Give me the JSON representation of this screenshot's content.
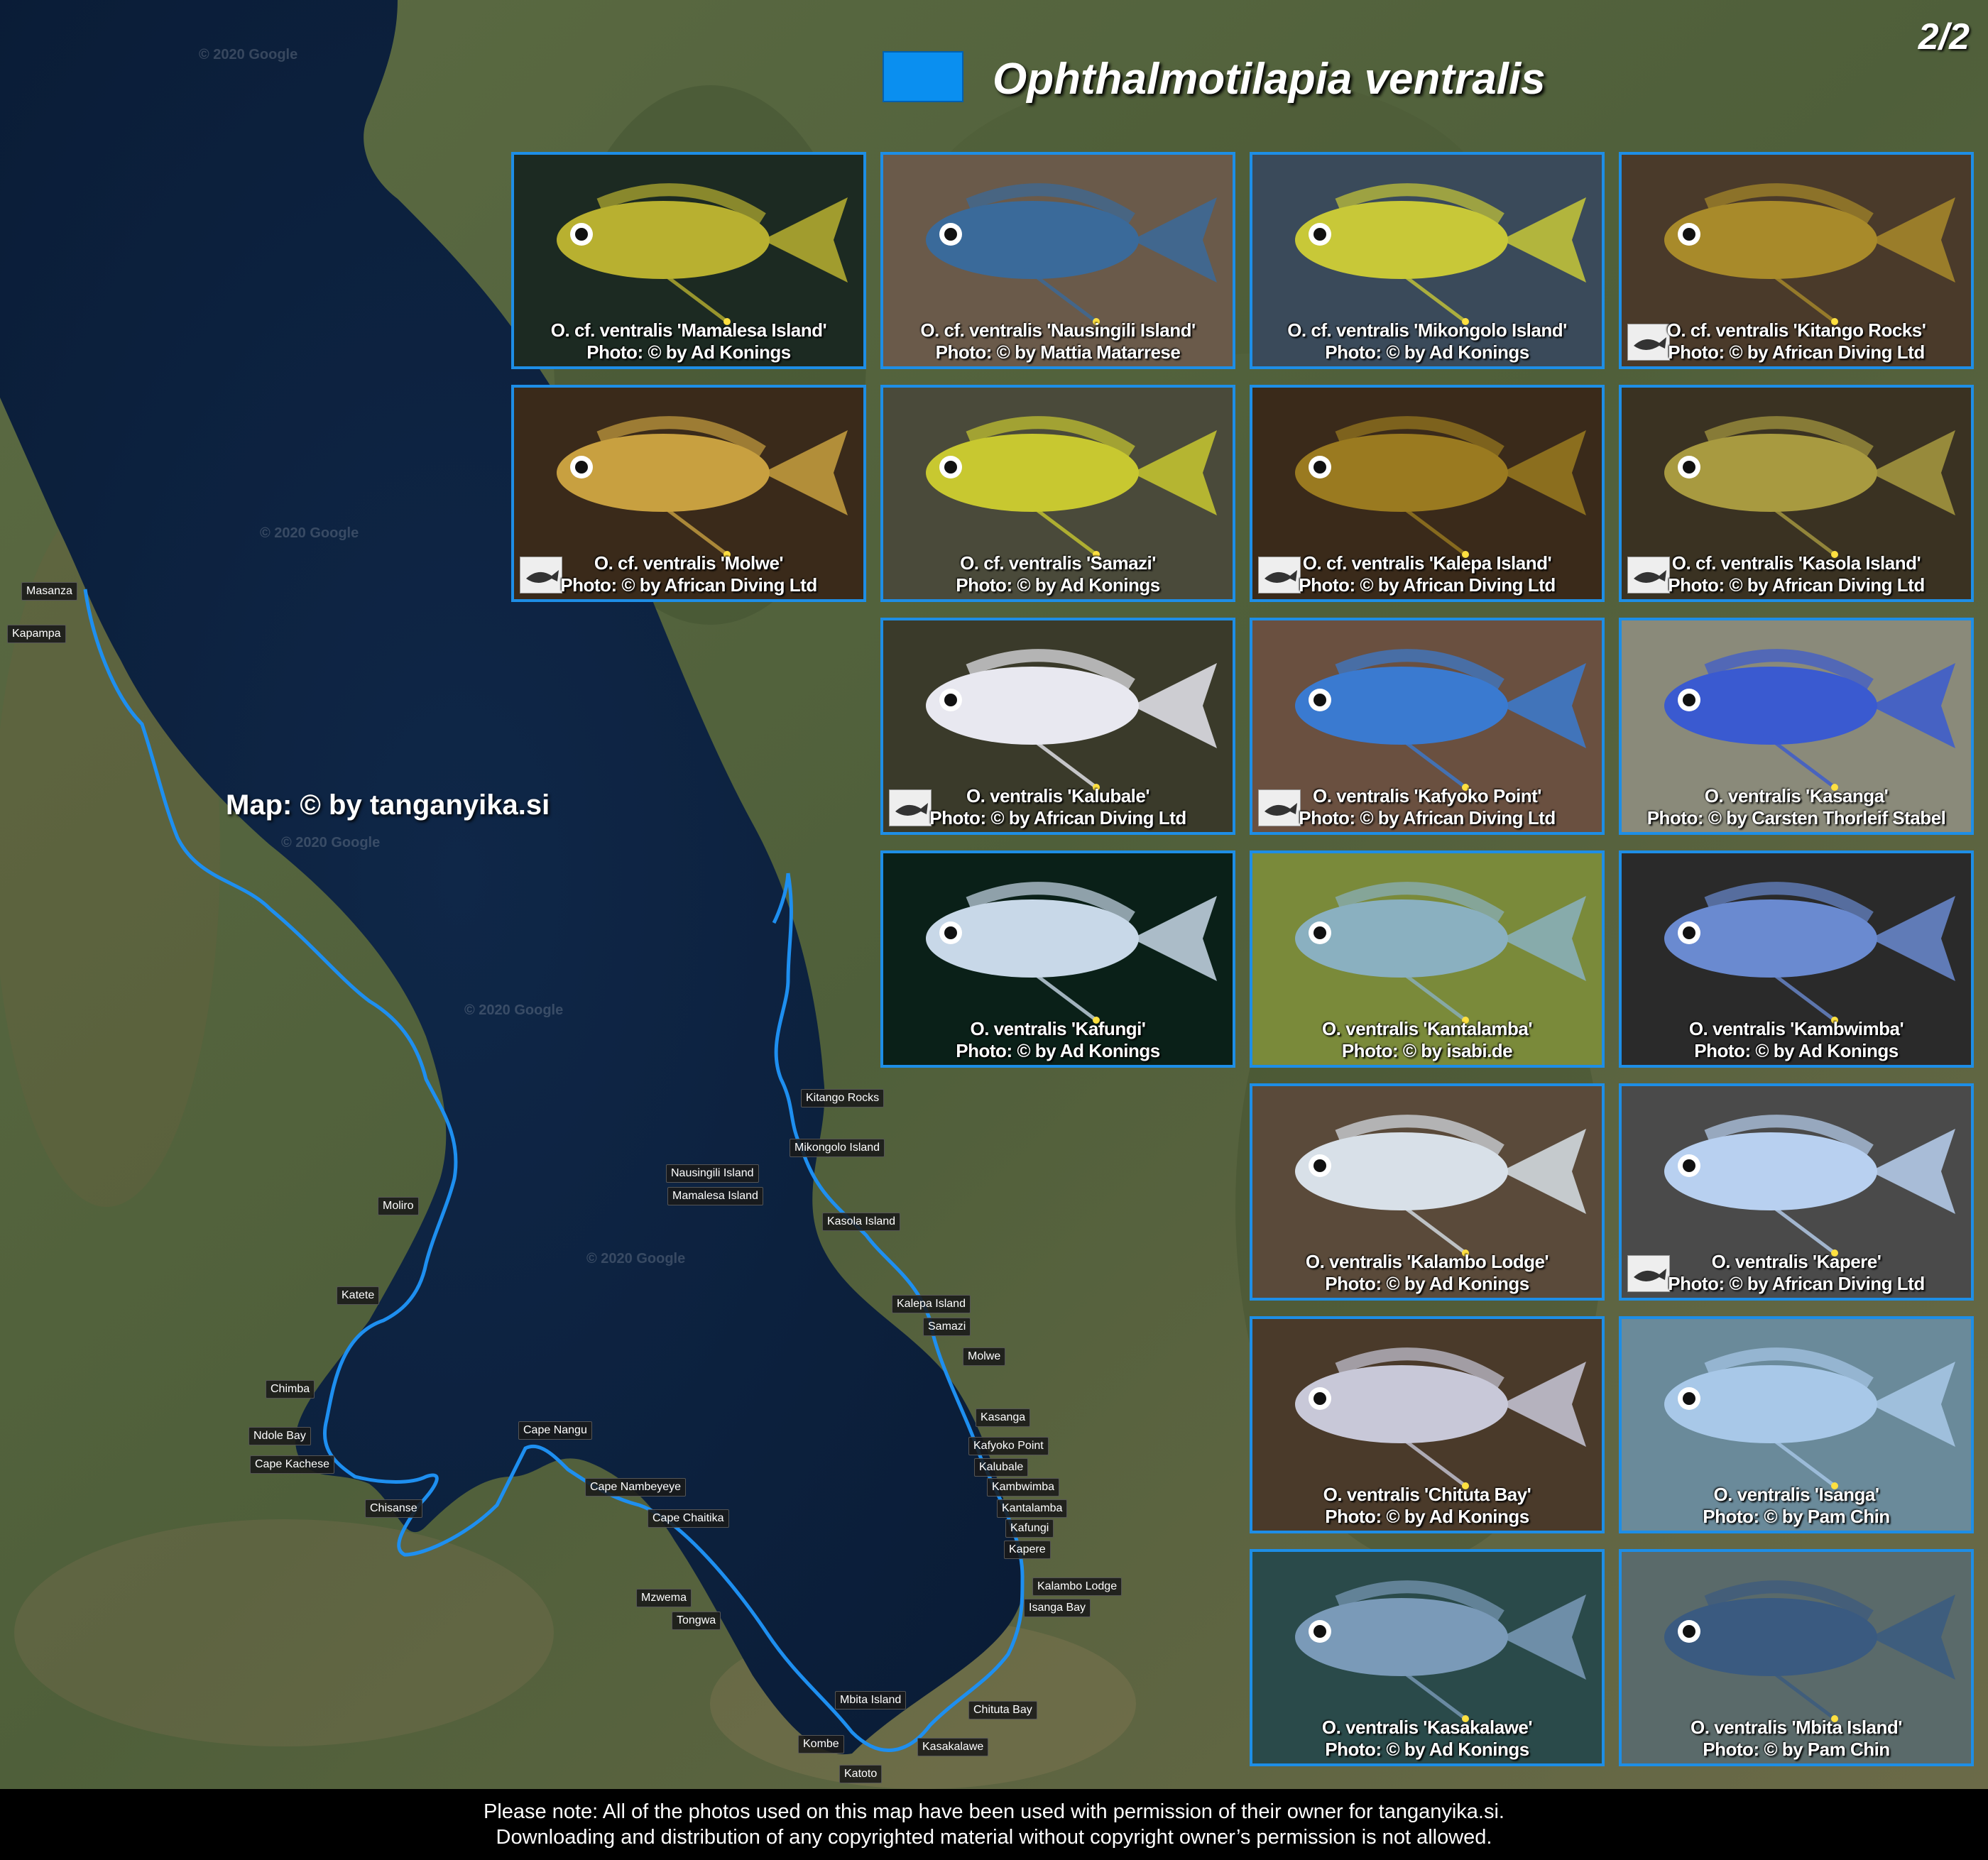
{
  "page_number": "2/2",
  "legend": {
    "color": "#0a8ff0",
    "species": "Ophthalmotilapia ventralis"
  },
  "map_credit": "Map: © by tanganyika.si",
  "watermark": "© 2020 Google",
  "locations": [
    "Masanza",
    "Kapampa",
    "Moliro",
    "Katete",
    "Chimba",
    "Ndole Bay",
    "Cape Kachese",
    "Chisanse",
    "Cape Nangu",
    "Cape Nambeyeye",
    "Cape Chaitika",
    "Mzwema",
    "Tongwa",
    "Mbita Island",
    "Kombe",
    "Katoto",
    "Kasakalawe",
    "Chituta Bay",
    "Isanga Bay",
    "Kalambo Lodge",
    "Kapere",
    "Kafungi",
    "Kantalamba",
    "Kambwimba",
    "Kalubale",
    "Kafyoko Point",
    "Kasanga",
    "Molwe",
    "Samazi",
    "Kalepa Island",
    "Kasola Island",
    "Mamalesa Island",
    "Nausingili Island",
    "Mikongolo Island",
    "Kitango Rocks"
  ],
  "photos": [
    {
      "name": "O. cf. ventralis 'Mamalesa Island'",
      "credit": "Photo: © by Ad Konings",
      "bg": "#1c2a22",
      "body": "#b8b030",
      "logo": false
    },
    {
      "name": "O. cf. ventralis 'Nausingili Island'",
      "credit": "Photo: © by Mattia Matarrese",
      "bg": "#6a5a4a",
      "body": "#3a6a9a",
      "logo": false
    },
    {
      "name": "O. cf. ventralis 'Mikongolo Island'",
      "credit": "Photo: © by Ad Konings",
      "bg": "#3a4a5a",
      "body": "#c8c838",
      "logo": false
    },
    {
      "name": "O. cf. ventralis 'Kitango Rocks'",
      "credit": "Photo: © by African Diving Ltd",
      "bg": "#4a3a2a",
      "body": "#a88a2a",
      "logo": true
    },
    {
      "name": "O. cf. ventralis 'Molwe'",
      "credit": "Photo: © by African Diving Ltd",
      "bg": "#3a2a1a",
      "body": "#c8a040",
      "logo": true
    },
    {
      "name": "O. cf. ventralis 'Samazi'",
      "credit": "Photo: © by Ad Konings",
      "bg": "#4a4a3a",
      "body": "#c8c830",
      "logo": false
    },
    {
      "name": "O. cf. ventralis 'Kalepa Island'",
      "credit": "Photo: © by African Diving Ltd",
      "bg": "#3a2a1a",
      "body": "#9a7a20",
      "logo": true
    },
    {
      "name": "O. cf. ventralis 'Kasola Island'",
      "credit": "Photo: © by African Diving Ltd",
      "bg": "#3a3222",
      "body": "#a89a40",
      "logo": true
    },
    {
      "name": "O. ventralis 'Kalubale'",
      "credit": "Photo: © by African Diving Ltd",
      "bg": "#3a3a2a",
      "body": "#e8e8f0",
      "logo": true
    },
    {
      "name": "O. ventralis 'Kafyoko Point'",
      "credit": "Photo: © by African Diving Ltd",
      "bg": "#6a5040",
      "body": "#3a7ad0",
      "logo": true
    },
    {
      "name": "O. ventralis 'Kasanga'",
      "credit": "Photo: © by Carsten Thorleif Stabel",
      "bg": "#8a8a7a",
      "body": "#3a5ad0",
      "logo": false
    },
    {
      "name": "O. ventralis 'Kafungi'",
      "credit": "Photo: © by Ad Konings",
      "bg": "#0a2018",
      "body": "#c8d8e8",
      "logo": false
    },
    {
      "name": "O. ventralis 'Kantalamba'",
      "credit": "Photo: © by isabi.de",
      "bg": "#7a8a3a",
      "body": "#8ab0c0",
      "logo": false
    },
    {
      "name": "O. ventralis 'Kambwimba'",
      "credit": "Photo: © by Ad Konings",
      "bg": "#2a2a2a",
      "body": "#6a8ad0",
      "logo": false
    },
    {
      "name": "O. ventralis 'Kalambo Lodge'",
      "credit": "Photo: © by Ad Konings",
      "bg": "#5a4a3a",
      "body": "#d8e0e8",
      "logo": false
    },
    {
      "name": "O. ventralis 'Kapere'",
      "credit": "Photo: © by African Diving Ltd",
      "bg": "#4a4a4a",
      "body": "#b8d0f0",
      "logo": true
    },
    {
      "name": "O. ventralis 'Chituta Bay'",
      "credit": "Photo: © by Ad Konings",
      "bg": "#4a3a2a",
      "body": "#c8c8d8",
      "logo": false
    },
    {
      "name": "O. ventralis 'Isanga'",
      "credit": "Photo: © by Pam Chin",
      "bg": "#6a8a9a",
      "body": "#a8c8e8",
      "logo": false
    },
    {
      "name": "O. ventralis 'Kasakalawe'",
      "credit": "Photo: © by Ad Konings",
      "bg": "#2a4a4a",
      "body": "#7a9ab8",
      "logo": false
    },
    {
      "name": "O. ventralis 'Mbita Island'",
      "credit": "Photo: © by Pam Chin",
      "bg": "#5a6a6a",
      "body": "#3a5a80",
      "logo": false
    }
  ],
  "footer": {
    "line1": "Please note: All of the photos used on this map have been used with permission of their owner for tanganyika.si.",
    "line2": "Downloading and distribution of any copyrighted material without copyright owner’s permission is not allowed."
  }
}
